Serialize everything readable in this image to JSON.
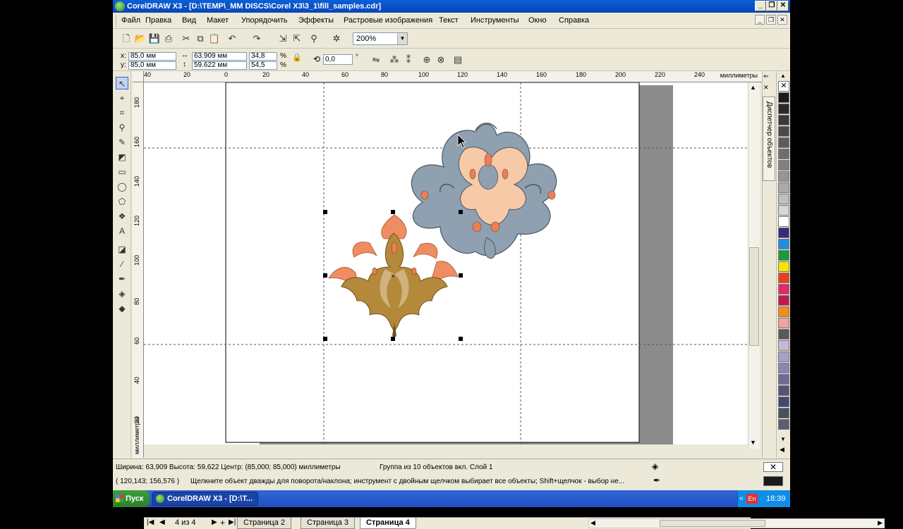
{
  "window": {
    "title": "CorelDRAW X3 - [D:\\TEMP\\_MM DISCS\\Corel X3\\3_1\\fill_samples.cdr]"
  },
  "menu": {
    "items": [
      "Файл",
      "Правка",
      "Вид",
      "Макет",
      "Упорядочить",
      "Эффекты",
      "Растровые изображения",
      "Текст",
      "Инструменты",
      "Окно",
      "Справка"
    ]
  },
  "toolbar": {
    "zoom": "200%"
  },
  "properties": {
    "x_label": "x:",
    "x": "85,0 мм",
    "y_label": "y:",
    "y": "85,0 мм",
    "width": "63.909 мм",
    "height": "59.622 мм",
    "scale_x": "34,8",
    "scale_y": "54,5",
    "percent": "%",
    "rotation": "0,0",
    "degree": "°"
  },
  "ruler": {
    "h_ticks": [
      "40",
      "20",
      "0",
      "20",
      "40",
      "60",
      "80",
      "100",
      "120",
      "140",
      "160",
      "180",
      "200",
      "220",
      "240"
    ],
    "h_unit": "миллиметры",
    "v_ticks": [
      "180",
      "160",
      "140",
      "120",
      "100",
      "80",
      "60",
      "40",
      "20"
    ],
    "v_unit": "миллиметры"
  },
  "pages": {
    "counter": "4 из 4",
    "tabs": [
      "Страница 2",
      "Страница 3",
      "Страница 4"
    ],
    "active": "Страница 4"
  },
  "docker": {
    "tab_label": "Диспетчер объектов"
  },
  "palette": {
    "colors": [
      "#ffffff",
      "#1a1a1a",
      "#2a2a2a",
      "#3a3a3a",
      "#4a4a4a",
      "#5c5c5c",
      "#6e6e6e",
      "#818181",
      "#959595",
      "#aaaaaa",
      "#c0c0c0",
      "#d6d6d6",
      "#ffffff",
      "#3b2a7a",
      "#1f8ee0",
      "#1a9a3a",
      "#f7e600",
      "#e8401c",
      "#e8266c",
      "#c21a4a",
      "#f28c1a",
      "#f3a0a0",
      "#5c5a55",
      "#c7b8d8",
      "#a9a0c8",
      "#8a87b5",
      "#6e6a9a",
      "#54517a",
      "#3f4b6e",
      "#4a4f63",
      "#5a5f70"
    ]
  },
  "status": {
    "dimensions": "Ширина: 63,909  Высота: 59,622  Центр: (85,000; 85,000)  миллиметры",
    "selection": "Группа из 10 объектов вкл. Слой 1",
    "coords": "( 120,143; 156,576 )",
    "hint": "Щелкните объект дважды для поворота/наклона; инструмент с двойным щелчком выбирает все объекты; Shift+щелчок - выбор не..."
  },
  "taskbar": {
    "start": "Пуск",
    "task": "CorelDRAW X3 - [D:\\T...",
    "lang": "En",
    "time": "18:39"
  },
  "art": {
    "gray": "#8fa0b0",
    "peach": "#f7c9a6",
    "orange": "#f07e52",
    "gold": "#b5893a",
    "salmon": "#f08c62"
  }
}
